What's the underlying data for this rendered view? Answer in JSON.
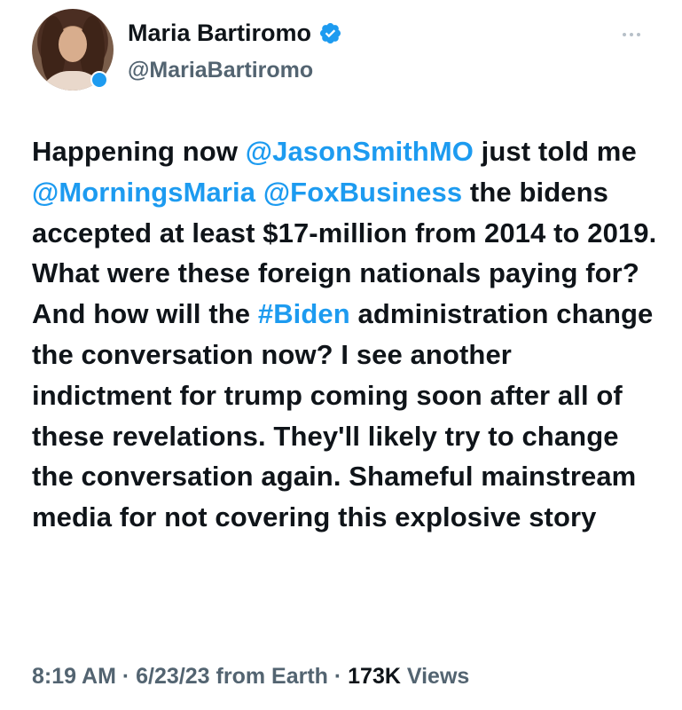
{
  "profile": {
    "name": "Maria Bartiromo",
    "handle": "@MariaBartiromo"
  },
  "tweet": {
    "segments": [
      {
        "text": "Happening now ",
        "type": "text"
      },
      {
        "text": "@JasonSmithMO",
        "type": "mention"
      },
      {
        "text": " just told me ",
        "type": "text"
      },
      {
        "text": "@MorningsMaria",
        "type": "mention"
      },
      {
        "text": " ",
        "type": "text"
      },
      {
        "text": "@FoxBusiness",
        "type": "mention"
      },
      {
        "text": " the bidens accepted at least $17-million from 2014 to 2019. What were these foreign nationals paying for? And how will the ",
        "type": "text"
      },
      {
        "text": "#Biden",
        "type": "hashtag"
      },
      {
        "text": " administration change the conversation now? I see another indictment for trump coming soon after all of these revelations. They'll likely try to change the conversation again. Shameful mainstream media for not covering this explosive story",
        "type": "text"
      }
    ]
  },
  "meta": {
    "time": "8:19 AM",
    "date": "6/23/23",
    "source": "from Earth",
    "views_count": "173K",
    "views_label": "Views",
    "separator": " · "
  },
  "colors": {
    "accent": "#1d9bf0",
    "text": "#0f1419",
    "muted": "#536471"
  },
  "icons": {
    "verified": "verified-badge-icon",
    "more": "more-options-icon"
  }
}
